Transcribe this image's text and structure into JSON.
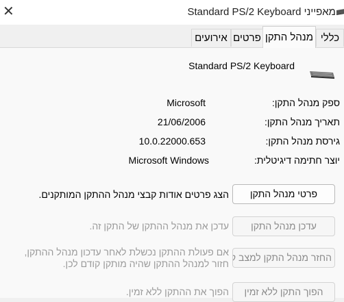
{
  "window": {
    "title": "מאפייני Standard PS/2 Keyboard",
    "close_icon": "close-icon"
  },
  "tabs": [
    {
      "label": "כללי",
      "active": false
    },
    {
      "label": "מנהל התקן",
      "active": true
    },
    {
      "label": "פרטים",
      "active": false
    },
    {
      "label": "אירועים",
      "active": false
    }
  ],
  "device": {
    "name": "Standard PS/2 Keyboard",
    "icon": "keyboard-icon"
  },
  "info_rows": [
    {
      "label": "ספק מנהל התקן:",
      "value": "Microsoft"
    },
    {
      "label": "תאריך מנהל התקן:",
      "value": "21/06/2006"
    },
    {
      "label": "גירסת מנהל התקן:",
      "value": "10.0.22000.653"
    },
    {
      "label": "יוצר חתימה דיגיטלית:",
      "value": "Microsoft Windows"
    }
  ],
  "actions": [
    {
      "button": "פרטי מנהל התקן",
      "description": "הצג פרטים אודות קבצי מנהל ההתקן המותקנים.",
      "enabled": true
    },
    {
      "button": "עדכן מנהל התקן",
      "description": "עדכן את מנהל ההתקן של התקן זה.",
      "enabled": false
    },
    {
      "button": "החזר מנהל התקן למצב קודם",
      "description": "אם פעולת ההתקן נכשלת לאחר עדכון מנהל ההתקן, חזור למנהל ההתקן שהיה מותקן קודם לכן.",
      "enabled": false
    },
    {
      "button": "הפוך התקן ללא זמין",
      "description": "הפוך את ההתקן ללא זמין.",
      "enabled": false
    }
  ],
  "colors": {
    "background": "#f0f0f0",
    "panel": "#f9f9f9",
    "disabled_text": "#9a9a9a"
  }
}
